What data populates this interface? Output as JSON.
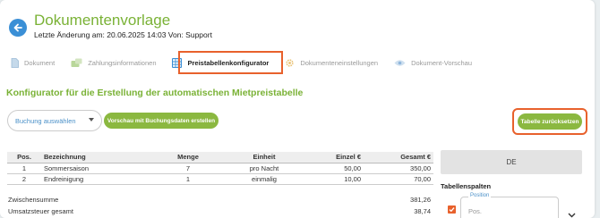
{
  "header": {
    "title": "Dokumentenvorlage",
    "subtitle": "Letzte Änderung am: 20.06.2025 14:03 Von: Support"
  },
  "tabs": [
    {
      "label": "Dokument",
      "icon": "document-icon",
      "active": false
    },
    {
      "label": "Zahlungsinformationen",
      "icon": "payment-icon",
      "active": false
    },
    {
      "label": "Preistabellenkonfigurator",
      "icon": "table-icon",
      "active": true
    },
    {
      "label": "Dokumenteneinstellungen",
      "icon": "gear-icon",
      "active": false
    },
    {
      "label": "Dokument-Vorschau",
      "icon": "eye-icon",
      "active": false
    }
  ],
  "section_heading": "Konfigurator für die Erstellung der automatischen Mietpreistabelle",
  "booking_select": {
    "placeholder": "Buchung auswählen"
  },
  "preview_button": "Vorschau mit Buchungsdaten erstellen",
  "reset_button": "Tabelle zurücksetzen",
  "table": {
    "headers": [
      "Pos.",
      "Bezeichnung",
      "Menge",
      "Einheit",
      "Einzel €",
      "Gesamt €"
    ],
    "rows": [
      [
        "1",
        "Sommersaison",
        "7",
        "pro Nacht",
        "50,00",
        "350,00"
      ],
      [
        "2",
        "Endreinigung",
        "1",
        "einmalig",
        "10,00",
        "70,00"
      ]
    ]
  },
  "summary": [
    {
      "label": "Zwischensumme",
      "value": "381,26"
    },
    {
      "label": "Umsatzsteuer gesamt",
      "value": "38,74"
    }
  ],
  "right_panel": {
    "language_button": "DE",
    "heading": "Tabellenspalten",
    "field_legend": "Position",
    "field_value": "Pos."
  },
  "colors": {
    "accent_green": "#7ab236",
    "highlight_orange": "#e8612c",
    "link_blue": "#4a90c8"
  }
}
